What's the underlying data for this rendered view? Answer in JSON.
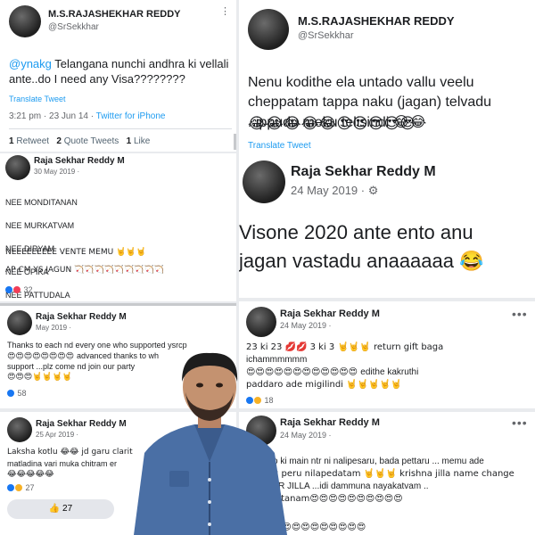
{
  "tweet1": {
    "name": "M.S.RAJASHEKHAR REDDY",
    "handle": "@SrSekkhar",
    "mention": "@ynakg",
    "text": " Telangana nunchi andhra ki vellali ante..do I need any Visa????????",
    "translate": "Translate Tweet",
    "time": "3:21 pm · 23 Jun 14 · ",
    "client": "Twitter for iPhone",
    "retweets": "1",
    "retweets_label": "Retweet",
    "quotes": "2",
    "quotes_label": "Quote Tweets",
    "likes": "1",
    "likes_label": "Like"
  },
  "tweet2": {
    "name": "M.S.RAJASHEKHAR REDDY",
    "handle": "@SrSekkhar",
    "text": "Nenu kodithe ela untado vallu veelu cheppatam tappa naku (jagan) telvadu ..ippudu meku telisindi",
    "emoji_line1": "😂😂",
    "emoji_line2": "😂😂😂😂😂😍😍😍😍😍",
    "translate": "Translate Tweet"
  },
  "post_left1": {
    "name": "Raja Sekhar Reddy M",
    "date": "30 May 2019 ·",
    "lines": [
      "NEE MONDITANAN",
      "NEE MURKATVAM",
      "NEE DIRYAM",
      "NEE OPIKA",
      "NEE PATTUDALA"
    ],
    "line_vente": "NEEEEEEEEE VENTE MEMU 🤘🤘🤘",
    "line_ap": "AP CM YS JAGUN 🏹🏹🏹🏹🏹🏹🏹🏹🏹",
    "reactions": "32"
  },
  "post_right1": {
    "name": "Raja Sekhar Reddy M",
    "date": "24 May 2019 ·",
    "text_line1": "Visone 2020 ante ento anu",
    "text_line2": "jagan vastadu anaaaaaa 😂"
  },
  "post_left2": {
    "name": "Raja Sekhar Reddy M",
    "date": "May 2019 ·",
    "text": "Thanks to each nd every one who supported ysrcp",
    "emoji_row": "😍😍😍😍😍😍😍😍",
    "text2": "advanced thanks to wh",
    "text3": "support ...plz come nd join  our party",
    "emoji_row2": "😍😍😍🤘🤘🤘🤘",
    "reactions": "58"
  },
  "post_right2": {
    "name": "Raja Sekhar Reddy M",
    "date": "24 May 2019 ·",
    "text1": "23 ki 23 💋💋 3 ki 3 🤘🤘🤘 return gift baga",
    "text2": "ichammmmmm",
    "emoji_row": "😍😍😍😍😍😍😍😍😍😍😍😍",
    "text3": "edithe kakruthi",
    "text4": "paddaro ade migilindi 🤘🤘🤘🤘🤘",
    "reactions": "18"
  },
  "post_left3": {
    "name": "Raja Sekhar Reddy M",
    "date": "25 Apr 2019 ·",
    "text1": "Laksha kotlu 😂😂 jd garu clarit",
    "text2": "matladina vari muka chitram er",
    "emoji_row": "😂😂😂😂😂",
    "reactions": "27",
    "like_count": "27"
  },
  "post_right3": {
    "name": "Raja Sekhar Reddy M",
    "date": "24 May 2019 ·",
    "text1": "o ki main ntr ni nalipesaru, bada pettaru ... memu ade",
    "text2": "2 peru nilapedatam 🤘🤘🤘 krishna jilla name change",
    "text3": "TR JILLA ...idi dammuna nayakatvam ..",
    "text4": "hitanam😍😍😍😍😍😍😍😍😍😍",
    "emoji_row": "😍😍😍😍😍😍😍😍😍😍"
  },
  "colors": {
    "twitter_blue": "#1d9bf0",
    "facebook_blue": "#1877f2",
    "page_bg": "#e9ebee",
    "shirt_blue": "#4a6fa5"
  }
}
